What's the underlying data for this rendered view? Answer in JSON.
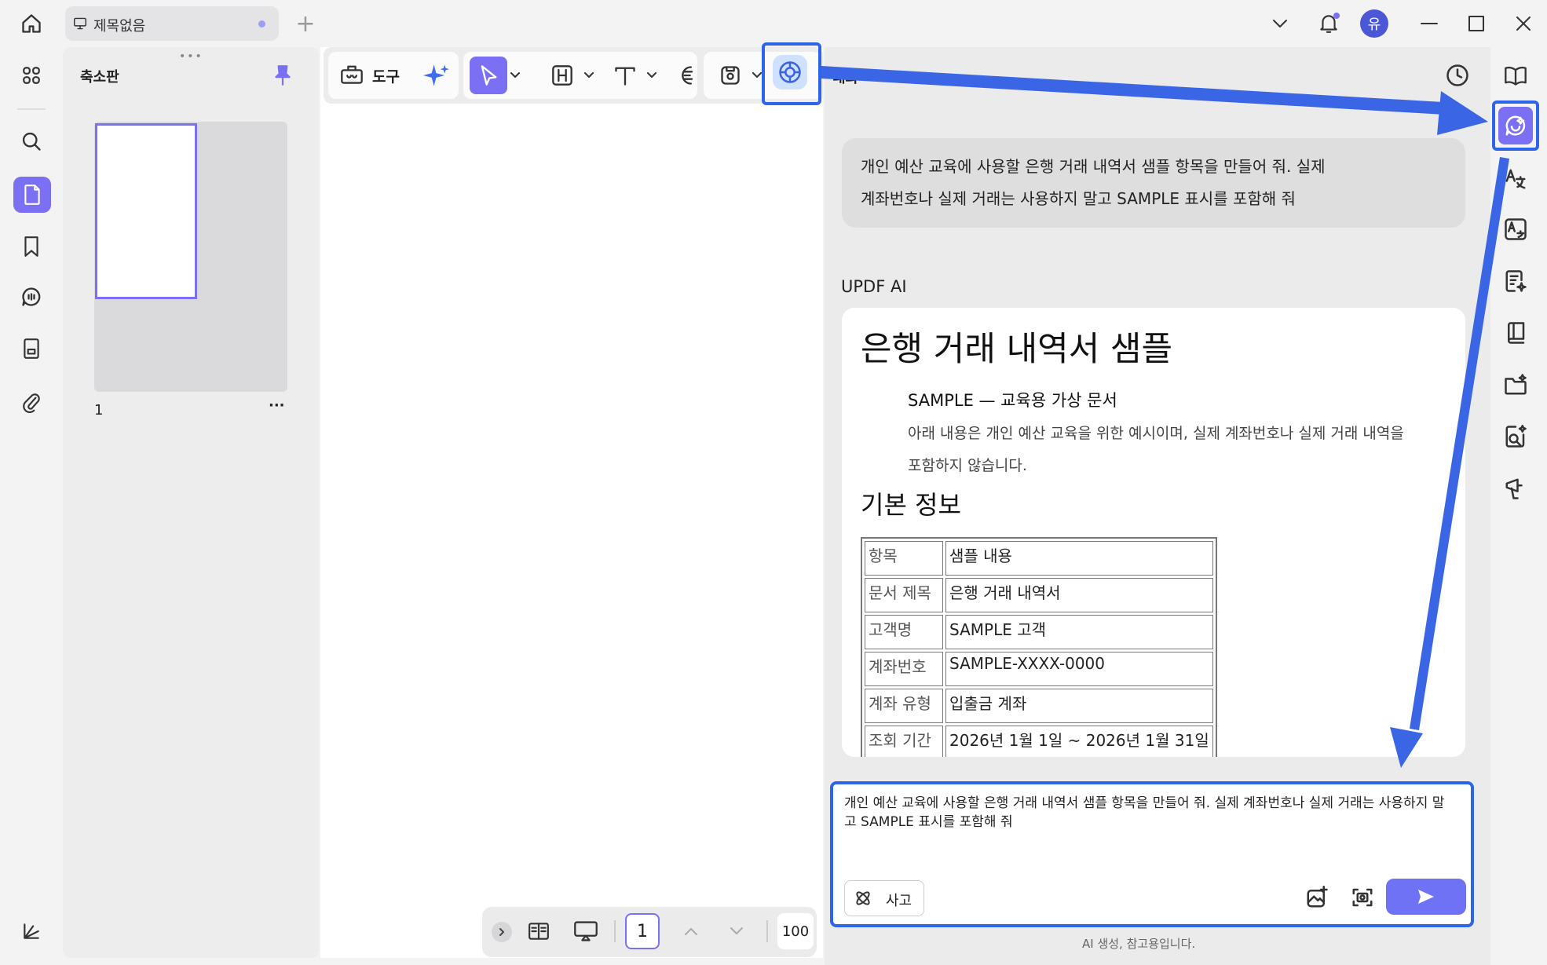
{
  "titlebar": {
    "tab_title": "제목없음",
    "new_tab_label": "+",
    "avatar_initial": "유"
  },
  "thumbnails": {
    "title": "축소판",
    "page_number": "1",
    "more_label": "···"
  },
  "toolbar": {
    "tools_label": "도구"
  },
  "pagebar": {
    "current_page": "1",
    "zoom": "100"
  },
  "chat": {
    "title": "대화",
    "user_message_line1": "개인 예산 교육에 사용할 은행 거래 내역서 샘플 항목을 만들어 줘. 실제",
    "user_message_line2": "계좌번호나 실제 거래는 사용하지 말고 SAMPLE 표시를 포함해 줘",
    "ai_name": "UPDF AI",
    "ai_response": {
      "heading": "은행 거래 내역서 샘플",
      "sample_note": "SAMPLE — 교육용 가상 문서",
      "paragraph": "아래 내용은 개인 예산 교육을 위한 예시이며, 실제 계좌번호나 실제 거래 내역을 포함하지 않습니다.",
      "section_heading": "기본 정보",
      "table": {
        "header": [
          "항목",
          "샘플 내용"
        ],
        "rows": [
          [
            "문서 제목",
            "은행 거래 내역서"
          ],
          [
            "고객명",
            "SAMPLE 고객"
          ],
          [
            "계좌번호",
            "SAMPLE-XXXX-0000"
          ],
          [
            "계좌 유형",
            "입출금 계좌"
          ],
          [
            "조회 기간",
            "2026년 1월 1일 ~ 2026년 1월 31일"
          ]
        ]
      }
    },
    "input_text": "개인 예산 교육에 사용할 은행 거래 내역서 샘플 항목을 만들어 줘. 실제 계좌번호나 실제 거래는 사용하지 말고 SAMPLE 표시를 포함해 줘",
    "think_label": "사고",
    "footer_note": "AI 생성, 참고용입니다."
  },
  "colors": {
    "accent": "#7b6ff3",
    "highlight": "#2d64e8",
    "send": "#6f72f5"
  }
}
